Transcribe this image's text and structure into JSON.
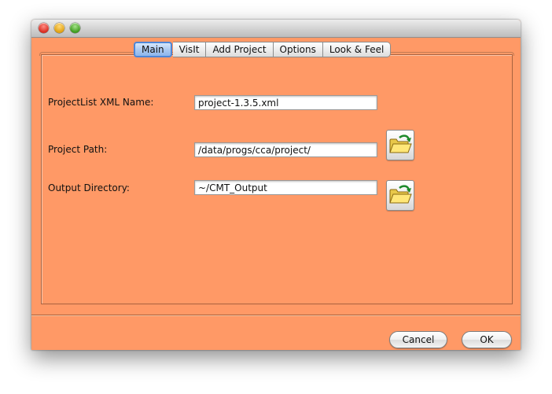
{
  "window": {
    "title": "",
    "background": "#ff9966"
  },
  "tabs": [
    {
      "label": "Main",
      "active": true
    },
    {
      "label": "VisIt",
      "active": false
    },
    {
      "label": "Add Project",
      "active": false
    },
    {
      "label": "Options",
      "active": false
    },
    {
      "label": "Look & Feel",
      "active": false
    }
  ],
  "form": {
    "projectlist_label": "ProjectList XML Name:",
    "projectlist_value": "project-1.3.5.xml",
    "project_path_label": "Project Path:",
    "project_path_value": "/data/progs/cca/project/",
    "output_dir_label": "Output Directory:",
    "output_dir_value": "~/CMT_Output"
  },
  "icons": {
    "folder": "open-folder-icon"
  },
  "buttons": {
    "cancel": "Cancel",
    "ok": "OK"
  }
}
